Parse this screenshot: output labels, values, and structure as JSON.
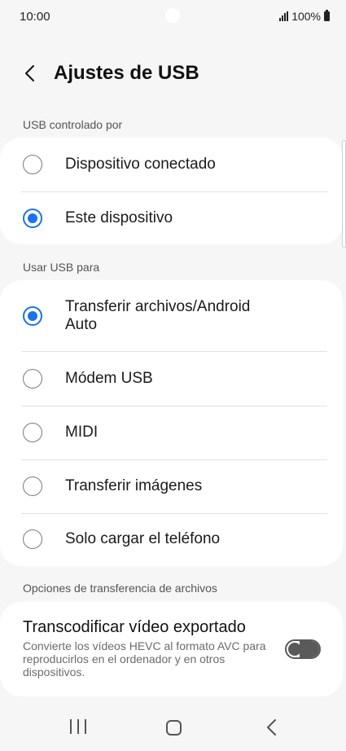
{
  "status_bar": {
    "time": "10:00",
    "battery": "100%"
  },
  "header": {
    "title": "Ajustes de USB"
  },
  "usb_controlled_by": {
    "label": "USB controlado por",
    "options": [
      {
        "label": "Dispositivo conectado",
        "checked": false
      },
      {
        "label": "Este dispositivo",
        "checked": true
      }
    ]
  },
  "use_usb_for": {
    "label": "Usar USB para",
    "options": [
      {
        "label": "Transferir archivos/Android Auto",
        "checked": true
      },
      {
        "label": "Módem USB",
        "checked": false
      },
      {
        "label": "MIDI",
        "checked": false
      },
      {
        "label": "Transferir imágenes",
        "checked": false
      },
      {
        "label": "Solo cargar el teléfono",
        "checked": false
      }
    ]
  },
  "file_transfer_options": {
    "label": "Opciones de transferencia de archivos",
    "transcode": {
      "title": "Transcodificar vídeo exportado",
      "description": "Convierte los vídeos HEVC al formato AVC para reproducirlos en el ordenador y en otros dispositivos.",
      "enabled": false
    }
  },
  "colors": {
    "accent": "#1a73e8",
    "background": "#f6f6f6",
    "card": "#ffffff"
  }
}
